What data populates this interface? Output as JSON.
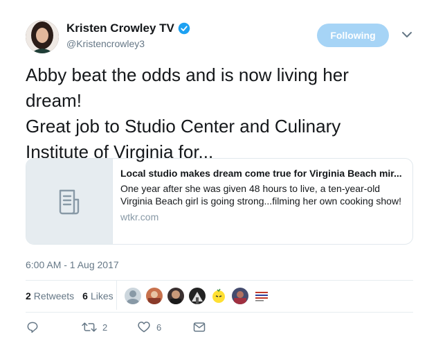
{
  "author": {
    "name": "Kristen Crowley TV",
    "handle": "@Kristencrowley3"
  },
  "follow_button": {
    "label": "Following"
  },
  "tweet": {
    "lines": [
      "Abby beat the odds and is now living her",
      "dream!",
      "Great job to Studio Center and Culinary",
      "Institute of Virginia for..."
    ]
  },
  "card": {
    "title": "Local studio makes dream come true for Virginia Beach mir...",
    "description_lines": [
      "One year after she was given 48 hours to live, a ten-year-old",
      "Virginia Beach girl is going strong...filming her own cooking show!"
    ],
    "domain": "wtkr.com"
  },
  "timestamp": "6:00 AM - 1 Aug 2017",
  "stats": {
    "retweets_count": "2",
    "retweets_label": "Retweets",
    "likes_count": "6",
    "likes_label": "Likes"
  },
  "actions": {
    "retweet_count": "2",
    "like_count": "6"
  },
  "icons": [
    "verified-badge",
    "chevron-down-icon",
    "document-icon",
    "reply-icon",
    "retweet-icon",
    "heart-icon",
    "mail-icon"
  ],
  "colors": {
    "accent": "#1da1f2",
    "following_button": "#a6d4f6",
    "muted_text": "#657786"
  }
}
